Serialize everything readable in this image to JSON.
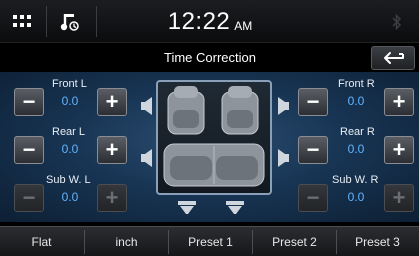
{
  "topbar": {
    "menu_icon": "grid-menu-icon",
    "media_icon": "music-note-icon",
    "clock_time": "12:22",
    "clock_ampm": "AM",
    "bt_icon": "bluetooth-icon"
  },
  "title": "Time Correction",
  "back_icon": "back-arrow-icon",
  "channels": {
    "front_l": {
      "label": "Front L",
      "value": "0.0"
    },
    "rear_l": {
      "label": "Rear L",
      "value": "0.0"
    },
    "sub_l": {
      "label": "Sub W. L",
      "value": "0.0"
    },
    "front_r": {
      "label": "Front R",
      "value": "0.0"
    },
    "rear_r": {
      "label": "Rear R",
      "value": "0.0"
    },
    "sub_r": {
      "label": "Sub W. R",
      "value": "0.0"
    }
  },
  "presets": [
    "Flat",
    "inch",
    "Preset 1",
    "Preset 2",
    "Preset 3"
  ]
}
